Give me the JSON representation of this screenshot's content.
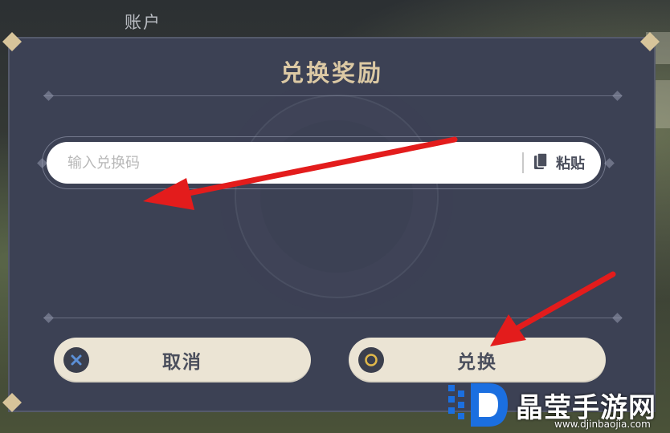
{
  "background": {
    "title": "账户"
  },
  "dialog": {
    "title": "兑换奖励",
    "input": {
      "placeholder": "输入兑换码",
      "value": ""
    },
    "paste_label": "粘贴",
    "cancel_label": "取消",
    "confirm_label": "兑换"
  },
  "watermark": {
    "text": "晶莹手游网",
    "url": "www.djinbaojia.com"
  },
  "colors": {
    "dialog_bg": "#3c4154",
    "title_gold": "#dcc9a4",
    "button_bg": "#ebe4d4",
    "cancel_icon": "#5b8fd6",
    "confirm_icon": "#e0b84a",
    "arrow_red": "#e31c1c",
    "watermark_blue": "#1b6fe0"
  },
  "icons": {
    "paste": "clipboard-icon",
    "cancel": "x-icon",
    "confirm": "circle-icon"
  }
}
